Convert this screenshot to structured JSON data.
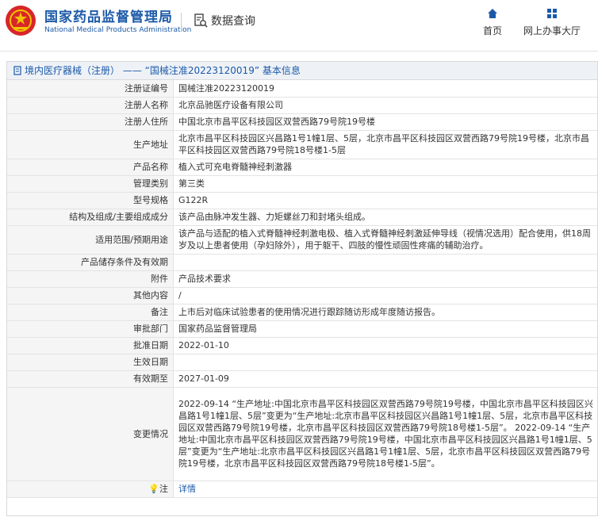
{
  "header": {
    "site_name_cn": "国家药品监督管理局",
    "site_name_en": "National Medical Products Administration",
    "query_label": "数据查询",
    "nav": [
      {
        "label": "首页",
        "icon": "home-icon"
      },
      {
        "label": "网上办事大厅",
        "icon": "grid-icon"
      }
    ]
  },
  "panel": {
    "title": "境内医疗器械（注册） —— “国械注准20223120019” 基本信息"
  },
  "rows": [
    {
      "label": "注册证编号",
      "value": "国械注准20223120019"
    },
    {
      "label": "注册人名称",
      "value": "北京品驰医疗设备有限公司"
    },
    {
      "label": "注册人住所",
      "value": "中国北京市昌平区科技园区双营西路79号院19号楼"
    },
    {
      "label": "生产地址",
      "value": "北京市昌平区科技园区兴昌路1号1幢1层、5层，北京市昌平区科技园区双营西路79号院19号楼，北京市昌平区科技园区双营西路79号院18号楼1-5层"
    },
    {
      "label": "产品名称",
      "value": "植入式可充电脊髓神经刺激器"
    },
    {
      "label": "管理类别",
      "value": "第三类"
    },
    {
      "label": "型号规格",
      "value": "G122R"
    },
    {
      "label": "结构及组成/主要组成成分",
      "value": "该产品由脉冲发生器、力矩螺丝刀和封堵头组成。"
    },
    {
      "label": "适用范围/预期用途",
      "value": "该产品与适配的植入式脊髓神经刺激电极、植入式脊髓神经刺激延伸导线（视情况选用）配合使用，供18周岁及以上患者使用（孕妇除外），用于躯干、四肢的慢性顽固性疼痛的辅助治疗。"
    },
    {
      "label": "产品储存条件及有效期",
      "value": ""
    },
    {
      "label": "附件",
      "value": "产品技术要求"
    },
    {
      "label": "其他内容",
      "value": "/"
    },
    {
      "label": "备注",
      "value": "上市后对临床试验患者的使用情况进行跟踪随访形成年度随访报告。"
    },
    {
      "label": "审批部门",
      "value": "国家药品监督管理局"
    },
    {
      "label": "批准日期",
      "value": "2022-01-10"
    },
    {
      "label": "生效日期",
      "value": ""
    },
    {
      "label": "有效期至",
      "value": "2027-01-09"
    },
    {
      "label": "变更情况",
      "value": "2022-09-14 “生产地址:中国北京市昌平区科技园区双营西路79号院19号楼，中国北京市昌平区科技园区兴昌路1号1幢1层、5层”变更为“生产地址:北京市昌平区科技园区兴昌路1号1幢1层、5层，北京市昌平区科技园区双营西路79号院19号楼，北京市昌平区科技园区双营西路79号院18号楼1-5层”。 2022-09-14 “生产地址:中国北京市昌平区科技园区双营西路79号院19号楼，中国北京市昌平区科技园区兴昌路1号1幢1层、5层”变更为“生产地址:北京市昌平区科技园区兴昌路1号1幢1层、5层，北京市昌平区科技园区双营西路79号院19号楼，北京市昌平区科技园区双营西路79号院18号楼1-5层”。"
    },
    {
      "label": "注",
      "value": "详情"
    }
  ],
  "colors": {
    "brand": "#1c5aa8",
    "emblem_red": "#d7262a"
  }
}
